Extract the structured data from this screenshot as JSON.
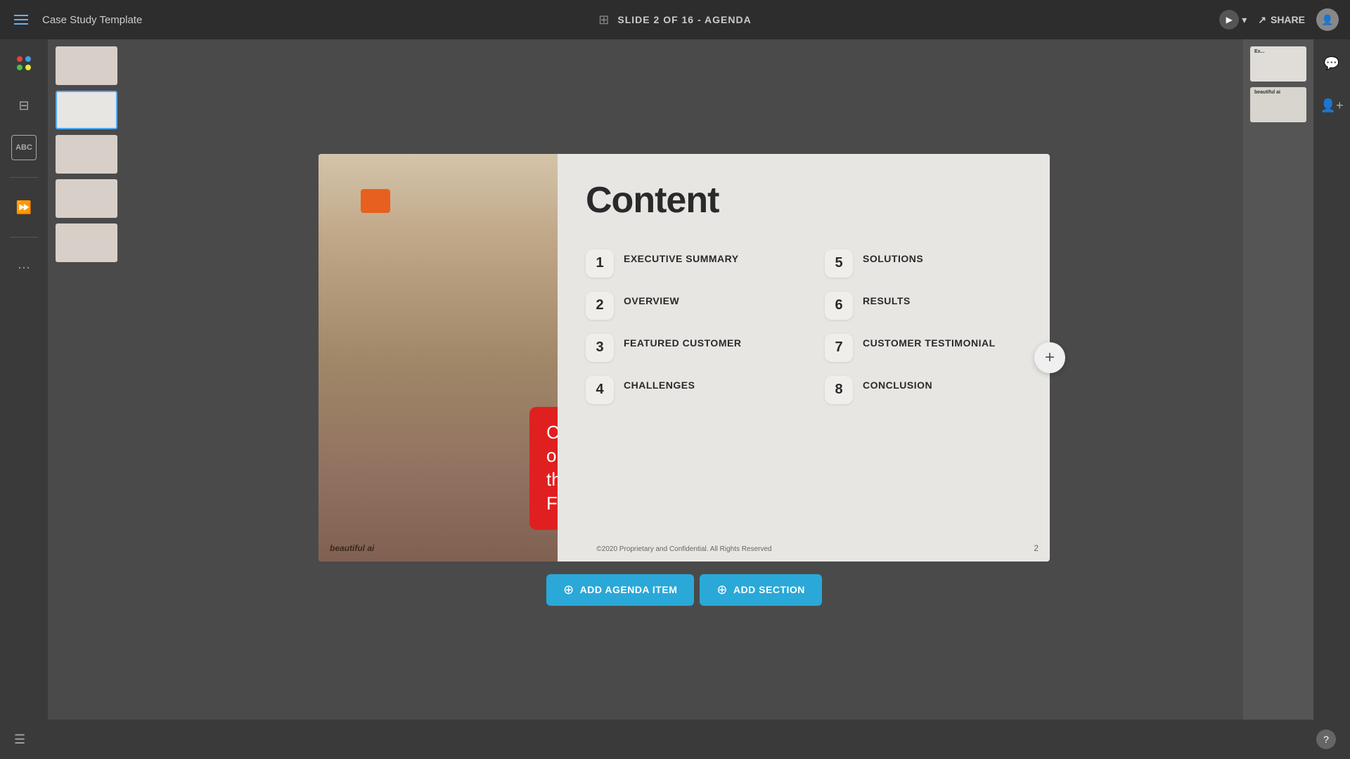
{
  "app": {
    "title": "Case Study Template",
    "slide_label": "SLIDE 2 OF 16 - AGENDA",
    "share_label": "SHARE"
  },
  "slide": {
    "title": "Content",
    "agenda_items": [
      {
        "number": "1",
        "text": "EXECUTIVE SUMMARY"
      },
      {
        "number": "5",
        "text": "SOLUTIONS"
      },
      {
        "number": "2",
        "text": "OVERVIEW"
      },
      {
        "number": "6",
        "text": "RESULTS"
      },
      {
        "number": "3",
        "text": "FEATURED CUSTOMER"
      },
      {
        "number": "7",
        "text": "CUSTOMER TESTIMONIAL"
      },
      {
        "number": "4",
        "text": "CHALLENGES"
      },
      {
        "number": "8",
        "text": "CONCLUSION"
      }
    ],
    "callout_text": "Click on\nthe Footer",
    "watermark": "beautiful ai",
    "footer": "©2020 Proprietary and Confidential. All Rights Reserved",
    "page_number": "2"
  },
  "buttons": {
    "add_agenda_item": "ADD AGENDA ITEM",
    "add_section": "ADD SECTION"
  },
  "sidebar": {
    "icons": [
      "☰",
      "▦",
      "ABC",
      "⋯",
      "⊞"
    ]
  }
}
